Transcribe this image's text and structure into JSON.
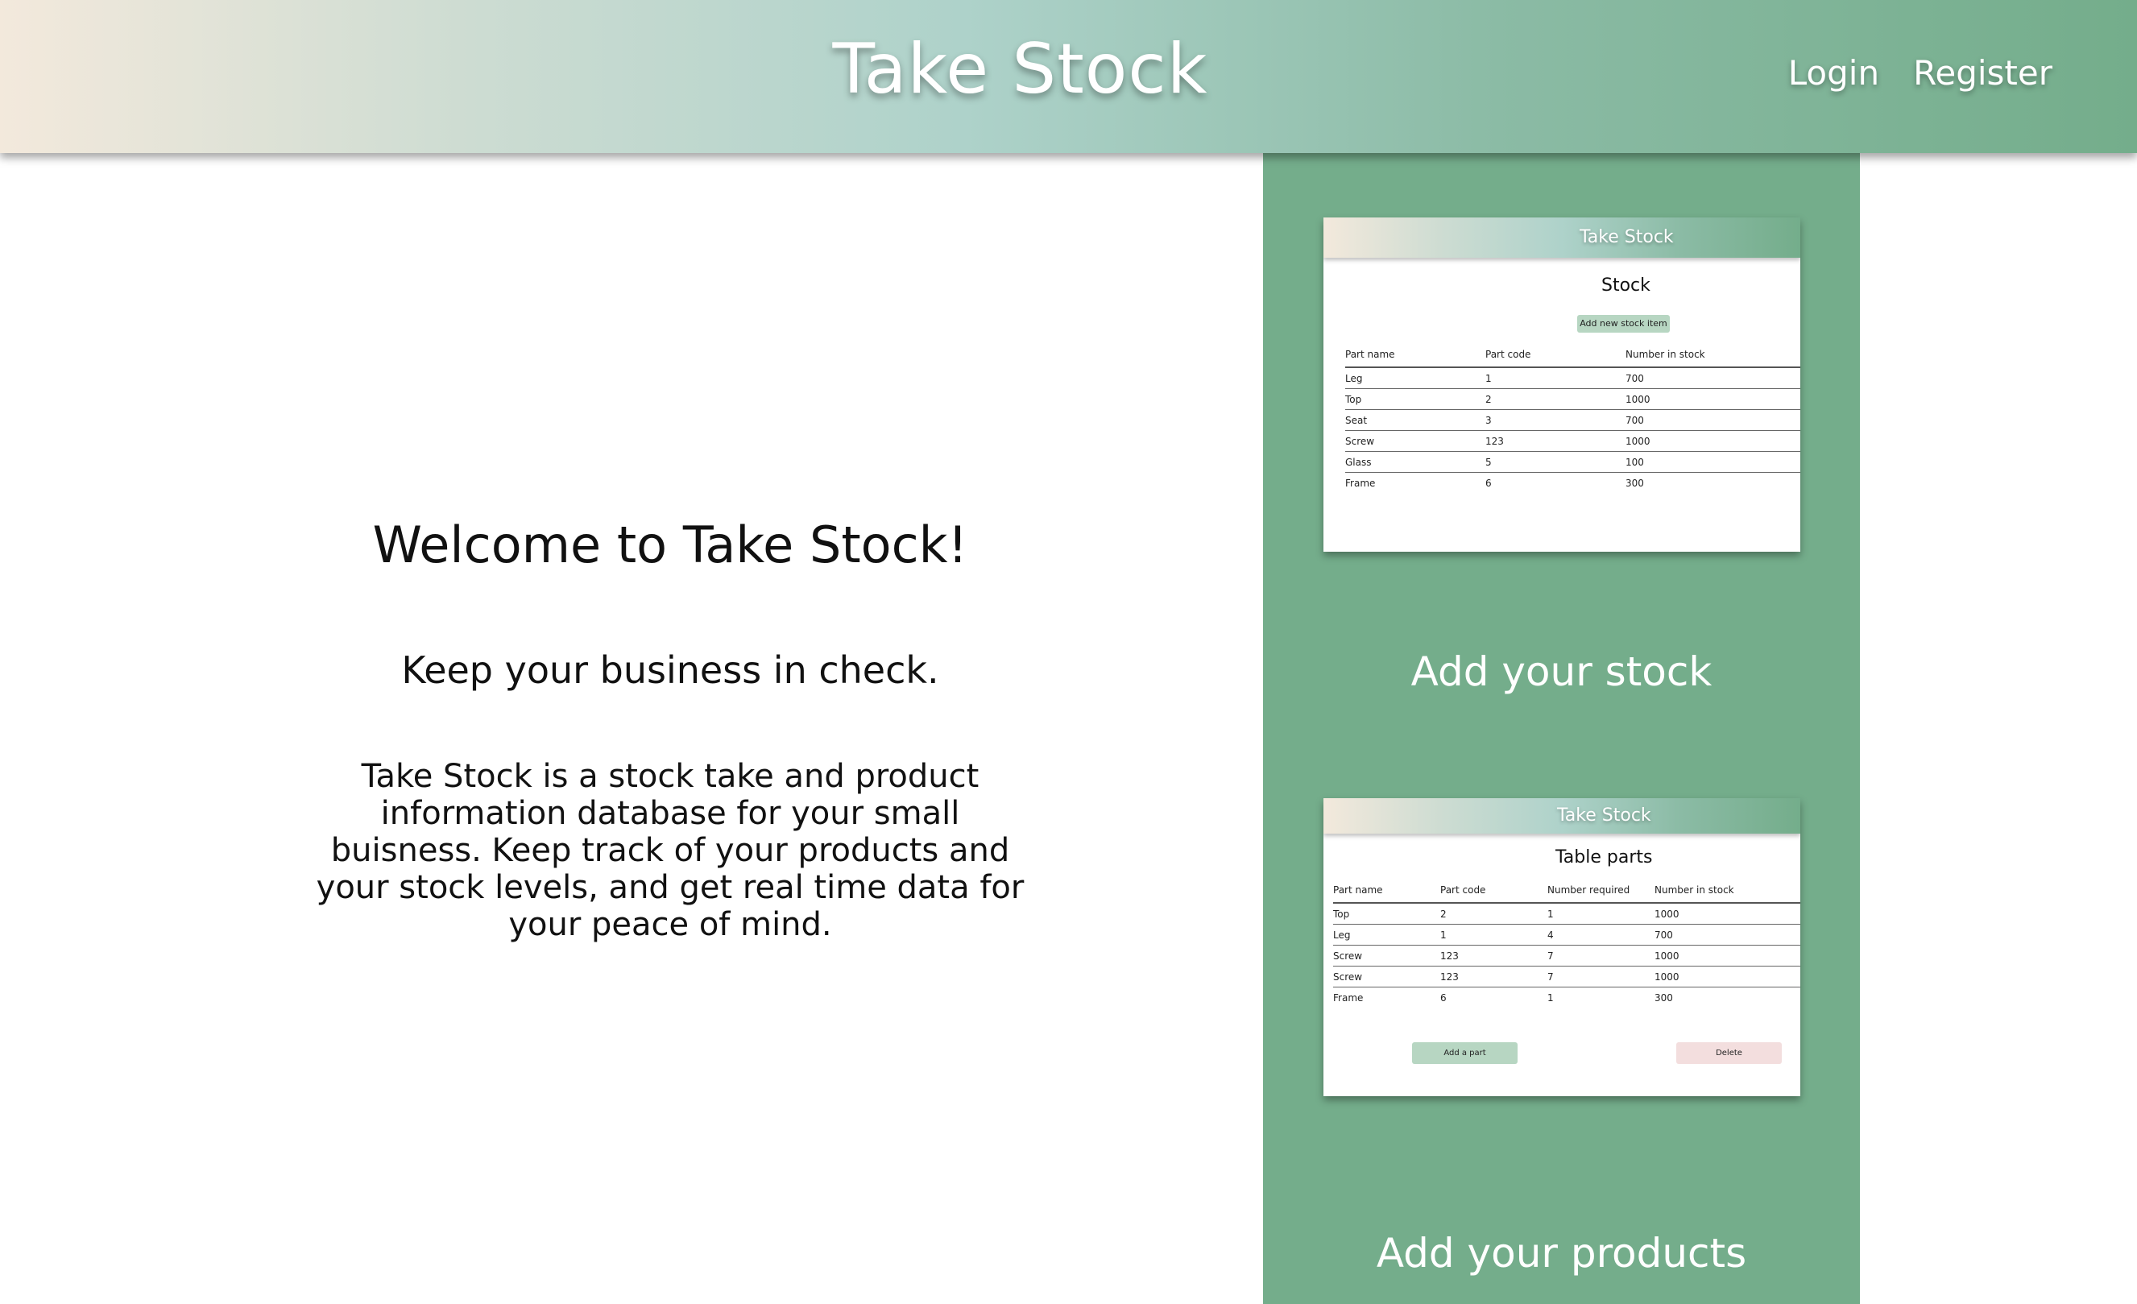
{
  "header": {
    "brand": "Take Stock",
    "nav": {
      "login": "Login",
      "register": "Register"
    }
  },
  "intro": {
    "welcome": "Welcome to Take Stock!",
    "tagline": "Keep your business in check.",
    "description": "Take Stock is a stock take and product information database for your small buisness. Keep track of your products and your stock levels, and get real time data for your peace of mind."
  },
  "features": {
    "stock": {
      "brand": "Take Stock",
      "title": "Stock",
      "add_button": "Add new stock item",
      "columns": [
        "Part name",
        "Part code",
        "Number in stock"
      ],
      "rows": [
        [
          "Leg",
          "1",
          "700"
        ],
        [
          "Top",
          "2",
          "1000"
        ],
        [
          "Seat",
          "3",
          "700"
        ],
        [
          "Screw",
          "123",
          "1000"
        ],
        [
          "Glass",
          "5",
          "100"
        ],
        [
          "Frame",
          "6",
          "300"
        ]
      ],
      "caption": "Add your stock"
    },
    "products": {
      "brand": "Take Stock",
      "title": "Table parts",
      "columns": [
        "Part name",
        "Part code",
        "Number required",
        "Number in stock"
      ],
      "rows": [
        [
          "Top",
          "2",
          "1",
          "1000"
        ],
        [
          "Leg",
          "1",
          "4",
          "700"
        ],
        [
          "Screw",
          "123",
          "7",
          "1000"
        ],
        [
          "Screw",
          "123",
          "7",
          "1000"
        ],
        [
          "Frame",
          "6",
          "1",
          "300"
        ]
      ],
      "add_button": "Add a part",
      "delete_button": "Delete",
      "caption": "Add your products"
    }
  },
  "colors": {
    "panel_green": "#74ad8b",
    "header_gradient_start": "#f3e9dc",
    "header_gradient_end": "#74ad8b",
    "add_button": "#b7d6c2",
    "delete_button": "#f3dede"
  }
}
